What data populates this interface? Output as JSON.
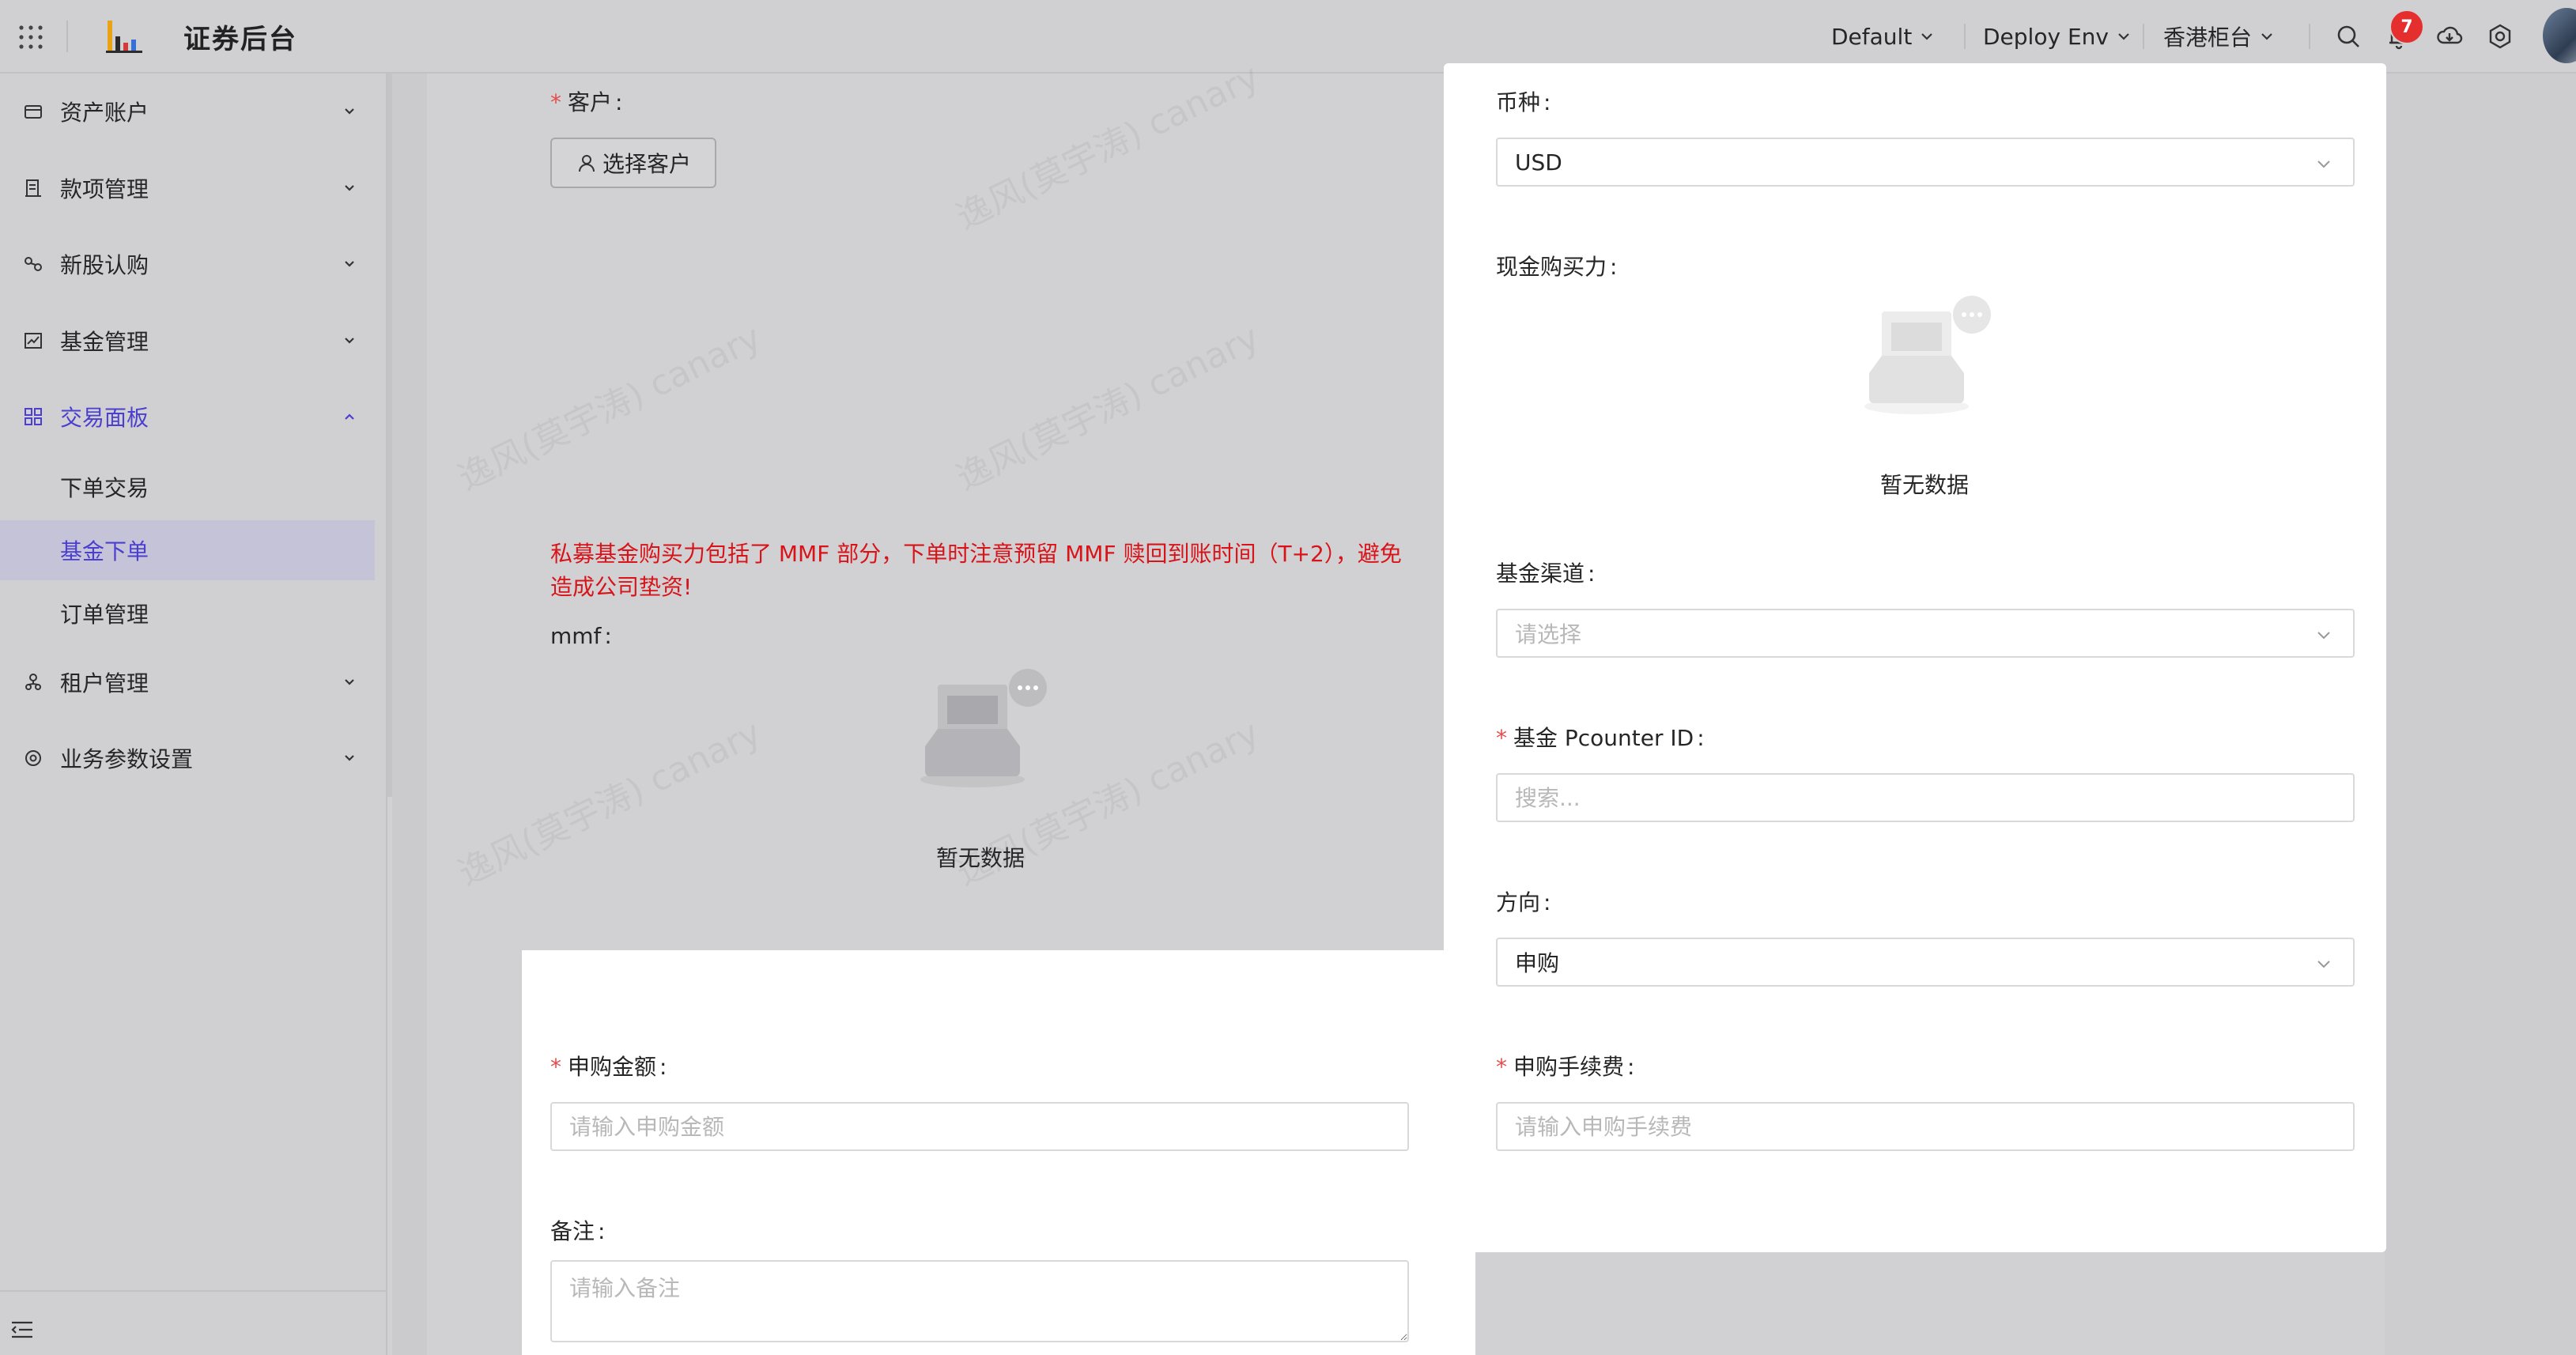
{
  "header": {
    "app_title": "证券后台",
    "env_default": "Default",
    "deploy_env": "Deploy Env",
    "counter": "香港柜台",
    "notification_count": "7"
  },
  "sidebar": {
    "items": [
      {
        "label": "资产账户",
        "icon": "wallet-icon"
      },
      {
        "label": "款项管理",
        "icon": "ledger-icon"
      },
      {
        "label": "新股认购",
        "icon": "ipo-icon"
      },
      {
        "label": "基金管理",
        "icon": "chart-icon"
      },
      {
        "label": "交易面板",
        "icon": "grid-icon",
        "expanded": true
      },
      {
        "label": "租户管理",
        "icon": "users-icon"
      },
      {
        "label": "业务参数设置",
        "icon": "settings-icon"
      }
    ],
    "sub_items": [
      {
        "label": "下单交易"
      },
      {
        "label": "基金下单",
        "selected": true
      },
      {
        "label": "订单管理"
      }
    ]
  },
  "form": {
    "client_label": "客户",
    "select_client_button": "选择客户",
    "warning": "私募基金购买力包括了 MMF 部分，下单时注意预留 MMF 赎回到账时间（T+2），避免造成公司垫资!",
    "mmf_label": "mmf",
    "empty_text": "暂无数据",
    "currency_label": "币种",
    "currency_value": "USD",
    "cash_power_label": "现金购买力",
    "channel_label": "基金渠道",
    "channel_placeholder": "请选择",
    "pcounter_label": "基金 Pcounter ID",
    "pcounter_placeholder": "搜索...",
    "direction_label": "方向",
    "direction_value": "申购",
    "amount_label": "申购金额",
    "amount_placeholder": "请输入申购金额",
    "fee_label": "申购手续费",
    "fee_placeholder": "请输入申购手续费",
    "remark_label": "备注",
    "remark_placeholder": "请输入备注"
  },
  "watermark_text": "逸风(莫宇涛) canary",
  "colors": {
    "accent": "#4b3fcf",
    "required": "#e34d4d",
    "warning": "#d8141a",
    "badge": "#e52e2e"
  }
}
